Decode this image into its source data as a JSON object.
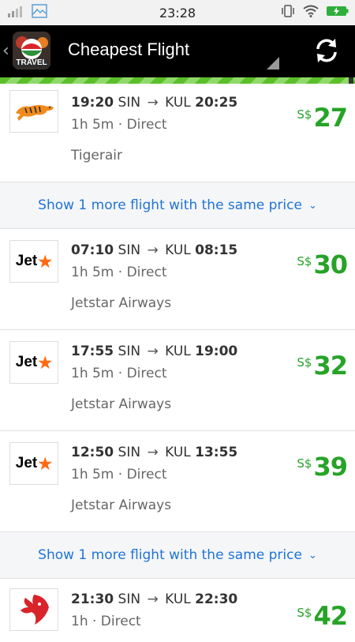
{
  "status_bar": {
    "time": "23:28",
    "icons": [
      "signal-icon",
      "image-icon",
      "vibrate-icon",
      "wifi-icon",
      "battery-icon"
    ]
  },
  "app_bar": {
    "back_glyph": "‹",
    "logo_label": "TRAVEL",
    "title": "Cheapest Flight",
    "refresh_icon": "refresh-icon"
  },
  "colors": {
    "price": "#27a327",
    "link": "#1f74d6",
    "stripe": "#5bbf2a",
    "jetstar_star": "#ff6a13"
  },
  "flights": [
    {
      "depart": "19:20",
      "from": "SIN",
      "arrow": "→",
      "to": "KUL",
      "arrive": "20:25",
      "duration": "1h 5m · Direct",
      "airline": "Tigerair",
      "currency": "S$",
      "price": "27",
      "logo": "tigerair-logo"
    },
    {
      "depart": "07:10",
      "from": "SIN",
      "arrow": "→",
      "to": "KUL",
      "arrive": "08:15",
      "duration": "1h 5m · Direct",
      "airline": "Jetstar Airways",
      "currency": "S$",
      "price": "30",
      "logo": "jetstar-logo"
    },
    {
      "depart": "17:55",
      "from": "SIN",
      "arrow": "→",
      "to": "KUL",
      "arrive": "19:00",
      "duration": "1h 5m · Direct",
      "airline": "Jetstar Airways",
      "currency": "S$",
      "price": "32",
      "logo": "jetstar-logo"
    },
    {
      "depart": "12:50",
      "from": "SIN",
      "arrow": "→",
      "to": "KUL",
      "arrive": "13:55",
      "duration": "1h 5m · Direct",
      "airline": "Jetstar Airways",
      "currency": "S$",
      "price": "39",
      "logo": "jetstar-logo"
    },
    {
      "depart": "21:30",
      "from": "SIN",
      "arrow": "→",
      "to": "KUL",
      "arrive": "22:30",
      "duration": "1h · Direct",
      "airline": "",
      "currency": "S$",
      "price": "42",
      "logo": "malindo-logo"
    }
  ],
  "more_links": [
    {
      "label": "Show 1 more flight with the same price",
      "chevron": "⌄"
    },
    {
      "label": "Show 1 more flight with the same price",
      "chevron": "⌄"
    }
  ],
  "logo_text": {
    "jetstar_word": "Jet",
    "jetstar_star": "★"
  }
}
